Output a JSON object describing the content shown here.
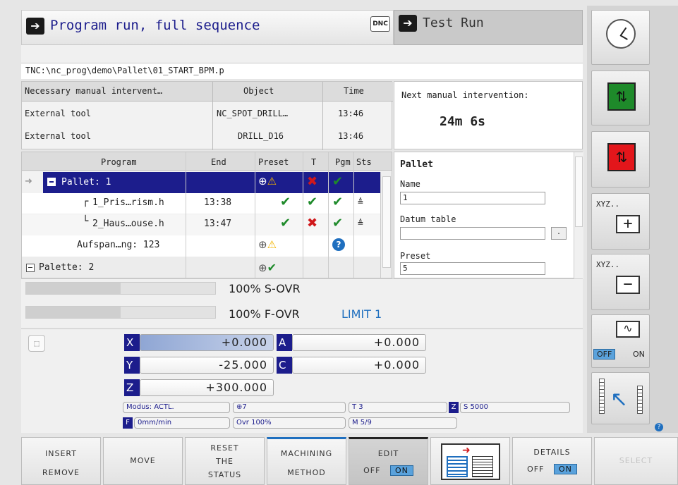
{
  "header": {
    "mode_title": "Program run, full sequence",
    "dnc_label": "DNC",
    "second_mode": "Test Run"
  },
  "path": "TNC:\\nc_prog\\demo\\Pallet\\01_START_BPM.p",
  "intervention_table": {
    "headers": [
      "Necessary manual intervent…",
      "Object",
      "Time"
    ],
    "rows": [
      [
        "External tool",
        "NC_SPOT_DRILL…",
        "13:46"
      ],
      [
        "External tool",
        "DRILL_D16",
        "13:46"
      ]
    ]
  },
  "next_intervention": {
    "label": "Next manual intervention:",
    "value": "24m 6s"
  },
  "program_table": {
    "headers": [
      "Program",
      "End",
      "Preset",
      "T",
      "Pgm",
      "Sts"
    ],
    "rows": [
      {
        "program": "Pallet: 1",
        "end": ""
      },
      {
        "program": "1_Pris…rism.h",
        "end": "13:38"
      },
      {
        "program": "2_Haus…ouse.h",
        "end": "13:47"
      },
      {
        "program": "Aufspan…ng: 123",
        "end": ""
      },
      {
        "program": "Palette: 2",
        "end": ""
      }
    ]
  },
  "pallet_panel": {
    "title": "Pallet",
    "name_label": "Name",
    "name_value": "1",
    "datum_label": "Datum table",
    "datum_value": "",
    "preset_label": "Preset",
    "preset_value": "5"
  },
  "overrides": {
    "s_ovr": "100% S-OVR",
    "f_ovr": "100% F-OVR",
    "limit": "LIMIT 1",
    "s_ovr_level": 0.5,
    "f_ovr_level": 0.5
  },
  "axes": [
    {
      "name": "X",
      "value": "+0.000"
    },
    {
      "name": "Y",
      "value": "-25.000"
    },
    {
      "name": "Z",
      "value": "+300.000"
    },
    {
      "name": "A",
      "value": "+0.000"
    },
    {
      "name": "C",
      "value": "+0.000"
    }
  ],
  "status": {
    "modus": "Modus: ACTL.",
    "preset": "7",
    "tool": "T 3",
    "spindle": "S 5000",
    "spindle_label": "Z",
    "feed": "0mm/min",
    "feed_label": "F",
    "ovr": "Ovr 100%",
    "m": "M 5/9"
  },
  "right_panel": {
    "xyz_plus": "XYZ..",
    "xyz_minus": "XYZ..",
    "off": "OFF",
    "on": "ON"
  },
  "softkeys": [
    {
      "l1": "INSERT",
      "l2": "REMOVE"
    },
    {
      "l1": "MOVE"
    },
    {
      "l1": "RESET",
      "l2": "THE",
      "l3": "STATUS"
    },
    {
      "l1": "MACHINING",
      "l2": "METHOD"
    },
    {
      "l1": "EDIT",
      "off": "OFF",
      "on": "ON"
    },
    {
      "l1": "DETAILS",
      "off": "OFF",
      "on": "ON"
    },
    {
      "l1": "SELECT"
    }
  ],
  "colors": {
    "selected_row": "#1c1d8c",
    "axis_label": "#1c1d8c",
    "check": "#1e8a2a",
    "cross": "#d0181b",
    "on_badge": "#5aa2dc"
  }
}
